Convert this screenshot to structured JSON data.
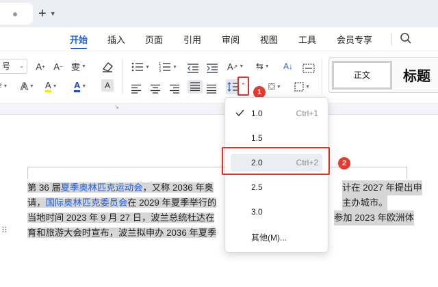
{
  "titlebar": {
    "new_tab_icon": "plus-icon"
  },
  "menu": {
    "tabs": [
      {
        "label": "开始",
        "active": true
      },
      {
        "label": "插入"
      },
      {
        "label": "页面"
      },
      {
        "label": "引用"
      },
      {
        "label": "审阅"
      },
      {
        "label": "视图"
      },
      {
        "label": "工具"
      },
      {
        "label": "会员专享"
      }
    ],
    "search_icon": "search-icon"
  },
  "ribbon": {
    "font_size_label": "号",
    "font_size_row2": "²",
    "bold_a": "A",
    "pinyin": "雯",
    "highlight_letter": "A",
    "font_color_letter": "A",
    "text_box_letter": "A",
    "grow_a": "A",
    "shrink_a": "A",
    "styles": {
      "normal": "正文",
      "heading": "标题"
    }
  },
  "badges": {
    "one": "1",
    "two": "2"
  },
  "accent_color": "#1f5fd8",
  "annotation_color": "#e0302a",
  "document": {
    "line1_pre": "第 36 届",
    "line1_link": "夏季奥林匹克运动会",
    "line1_mid": "，又称 2036 年奥",
    "line1_post": "计在 2027 年提出申",
    "line2_pre": "请，",
    "line2_link": "国际奥林匹克委员会",
    "line2_mid": "在 2029 年夏季举行的",
    "line2_post": "主办城市。",
    "line3_pre": "当地时间 2023 年 9 月 27 日，波兰总统杜达在",
    "line3_post": "参加 2023 年欧洲体",
    "line4_pre": "育和旅游大会时宣布，波兰拟申办 2036 年夏季"
  },
  "line_spacing_menu": {
    "selected": "1.0",
    "items": [
      {
        "value": "1.0",
        "shortcut": "Ctrl+1",
        "checked": true
      },
      {
        "value": "1.5",
        "shortcut": ""
      },
      {
        "value": "2.0",
        "shortcut": "Ctrl+2",
        "hovered": true
      },
      {
        "value": "2.5",
        "shortcut": ""
      },
      {
        "value": "3.0",
        "shortcut": ""
      },
      {
        "value": "其他(M)...",
        "shortcut": ""
      }
    ]
  }
}
